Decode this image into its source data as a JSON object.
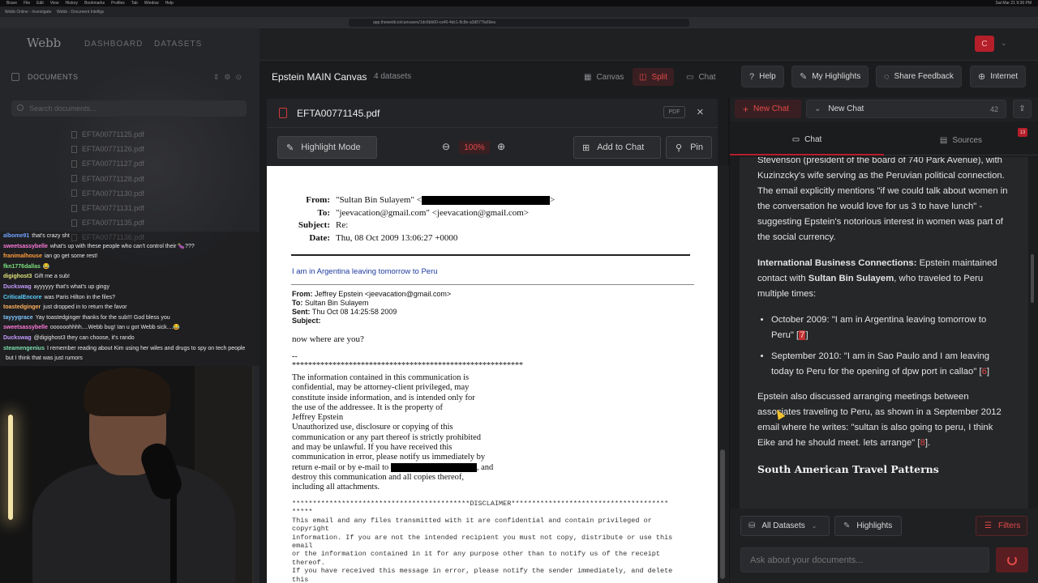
{
  "browser": {
    "os_menu": [
      "Brave",
      "File",
      "Edit",
      "View",
      "History",
      "Bookmarks",
      "Profiles",
      "Tab",
      "Window",
      "Help"
    ],
    "clock": "Sat Mar 21 9:36 PM",
    "tabs": [
      "Webb Online - Investigate Do",
      "Webb - Document Intelligence"
    ],
    "url": "app.thewebb.io/canvases/1dc6bb60-ca40-4dc1-8c8e-a3d577fa69ea"
  },
  "sidebar": {
    "brand": "Webb",
    "nav": [
      "DASHBOARD",
      "DATASETS"
    ],
    "docs_title": "DOCUMENTS",
    "search_placeholder": "Search documents...",
    "documents": [
      "EFTA00771125.pdf",
      "EFTA00771126.pdf",
      "EFTA00771127.pdf",
      "EFTA00771128.pdf",
      "EFTA00771130.pdf",
      "EFTA00771131.pdf",
      "EFTA00771135.pdf",
      "EFTA00771136.pdf"
    ]
  },
  "stream_chat": [
    {
      "user": "albome91",
      "color": "#6fa3ff",
      "text": "that's crazy sht"
    },
    {
      "user": "sweetsassybelle",
      "color": "#ff7ad9",
      "text": "what's up with these people who can't control their 🍆???"
    },
    {
      "user": "franimalhouse",
      "color": "#ff9d3b",
      "text": "ian go get some rest!"
    },
    {
      "user": "fkn1776dallas",
      "color": "#7be07b",
      "text": "😂"
    },
    {
      "user": "digighost3",
      "color": "#e2e27a",
      "text": "Gift me a sub!"
    },
    {
      "user": "Duckswag",
      "color": "#c59bff",
      "text": "ayyyyyy that's what's up gingy"
    },
    {
      "user": "CriticalEncore",
      "color": "#59d0ff",
      "text": "was Paris Hilton in the files?"
    },
    {
      "user": "toastedginger",
      "color": "#ffb15c",
      "text": "just dropped in to return the favor"
    },
    {
      "user": "tayyygrace",
      "color": "#7fc8ff",
      "text": "Yay toastedginger thanks for the sub!!! God bless you"
    },
    {
      "user": "sweetsassybelle",
      "color": "#ff7ad9",
      "text": "oooooohhhh....Webb bug! Ian u got Webb sick....😂"
    },
    {
      "user": "Duckswag",
      "color": "#c59bff",
      "text": "@digighost3 they can choose, it's rando"
    },
    {
      "user": "steamengenius",
      "color": "#7de0b0",
      "text": "I remember reading about Kim using her wiles and drugs to spy on tech people"
    },
    {
      "user": "",
      "color": "#e8e8e8",
      "text": "but I think that was just rumors"
    }
  ],
  "header": {
    "canvas_title": "Epstein MAIN Canvas",
    "dataset_count": "4 datasets",
    "view_modes": [
      "Canvas",
      "Split",
      "Chat"
    ],
    "active_mode": "Split",
    "buttons": [
      "Help",
      "My Highlights",
      "Share Feedback",
      "Internet"
    ],
    "avatar_initial": "C"
  },
  "pdf": {
    "filename": "EFTA00771145.pdf",
    "badge": "PDF",
    "highlight_mode": "Highlight Mode",
    "zoom": "100%",
    "add_to_chat": "Add to Chat",
    "pin": "Pin",
    "headers": [
      {
        "k": "From:",
        "v": "\"Sultan Bin Sulayem\" <",
        "redact": true,
        "tail": ">"
      },
      {
        "k": "To:",
        "v": "\"jeevacation@gmail.com\" <jeevacation@gmail.com>"
      },
      {
        "k": "Subject:",
        "v": "Re:"
      },
      {
        "k": "Date:",
        "v": "Thu, 08 Oct 2009 13:06:27 +0000"
      }
    ],
    "message": "I am in Argentina leaving tomorrow to Peru",
    "fwd_from": "Jeffrey Epstein <jeevacation@gmail.com>",
    "fwd_to": "Sultan Bin Sulayem",
    "fwd_sent": "Thu Oct 08 14:25:58 2009",
    "fwd_labels": [
      "From:",
      "To:",
      "Sent:",
      "Subject:"
    ],
    "body": "now where are you?",
    "separator": "--\n*********************************************************",
    "confidential": "The information contained in this communication is\nconfidential, may be attorney-client privileged, may\nconstitute inside information, and is intended only for\nthe use of the addressee. It is the property of\nJeffrey Epstein\nUnauthorized use, disclosure or copying of this\ncommunication or any part thereof is strictly prohibited\nand may be unlawful. If you have received this\ncommunication in error, please notify us immediately by\nreturn e-mail or by e-mail to",
    "confidential_tail": ", and\ndestroy this communication and all copies thereof,\nincluding all attachments.",
    "disclaimer": "*******************************************DISCLAIMER**************************************\n*****\nThis email and any files transmitted with it are confidential and contain privileged or\ncopyright\ninformation. If you are not the intended recipient you must not copy, distribute or use this\nemail\nor the information contained in it for any purpose other than to notify us of the receipt\nthereof.\nIf you have received this message in error, please notify the sender immediately, and delete\nthis"
  },
  "chat": {
    "new_chat": "New Chat",
    "chat_select": "New Chat",
    "chat_count": "42",
    "tabs": [
      "Chat",
      "Sources"
    ],
    "sources_badge": "13",
    "p1": "Stevenson (president of the board of 740 Park Avenue), with Kuzinzcky's wife serving as the Peruvian political connection. The email explicitly mentions \"if we could talk about women in the conversation he would love for us 3 to have lunch\" - suggesting Epstein's notorious interest in women was part of the social currency.",
    "p2_label": "International Business Connections:",
    "p2_a": " Epstein maintained contact with ",
    "p2_name": "Sultan Bin Sulayem",
    "p2_b": ", who traveled to Peru multiple times:",
    "b1": "October 2009: \"I am in Argentina leaving tomorrow to Peru\" [",
    "b1_cite": "7",
    "b2": "September 2010: \"I am in Sao Paulo and I am leaving today to Peru for the opening of dpw port in callao\" [",
    "b2_cite": "6",
    "p3": "Epstein also discussed arranging meetings between associates traveling to Peru, as shown in a September 2012 email where he writes: \"sultan is also going to peru, I think Eike and he should meet. lets arrange\" [",
    "p3_cite": "8",
    "h3": "South American Travel Patterns",
    "all_datasets": "All Datasets",
    "highlights": "Highlights",
    "filters": "Filters",
    "input_placeholder": "Ask about your documents..."
  }
}
